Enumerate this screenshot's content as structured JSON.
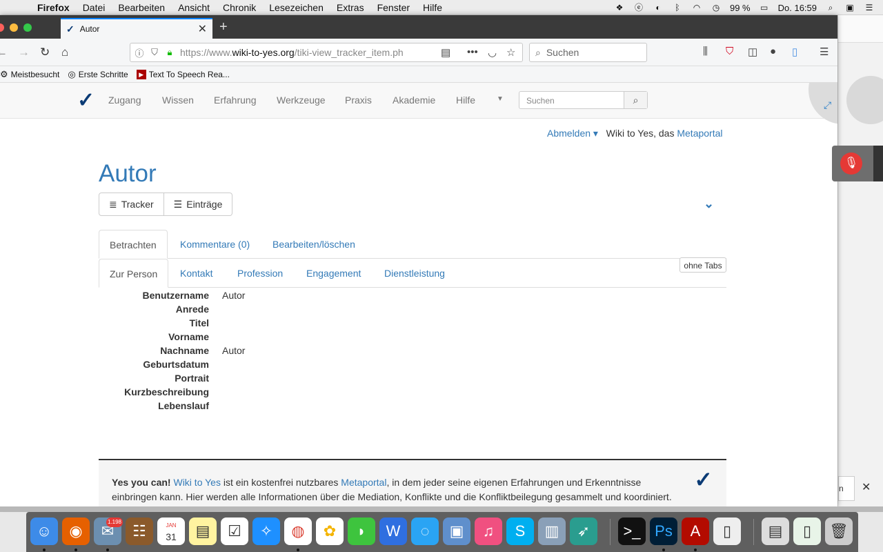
{
  "menubar": {
    "app": "Firefox",
    "items": [
      "Datei",
      "Bearbeiten",
      "Ansicht",
      "Chronik",
      "Lesezeichen",
      "Extras",
      "Fenster",
      "Hilfe"
    ],
    "battery": "99 %",
    "clock": "Do. 16:59"
  },
  "browser": {
    "tab_title": "Autor",
    "url_prefix": "https://www.",
    "url_domain": "wiki-to-yes.org",
    "url_rest": "/tiki-view_tracker_item.ph",
    "search_placeholder": "Suchen",
    "bookmarks": [
      "Meistbesucht",
      "Erste Schritte",
      "Text To Speech Rea..."
    ]
  },
  "site_nav": {
    "items": [
      "Zugang",
      "Wissen",
      "Erfahrung",
      "Werkzeuge",
      "Praxis",
      "Akademie",
      "Hilfe"
    ],
    "search_placeholder": "Suchen"
  },
  "user_line": {
    "logout": "Abmelden",
    "text": "Wiki to Yes, das",
    "link": "Metaportal"
  },
  "page": {
    "title": "Autor",
    "buttons": [
      "Tracker",
      "Einträge"
    ],
    "tabs_main": [
      "Betrachten",
      "Kommentare (0)",
      "Bearbeiten/löschen"
    ],
    "tabs_sub": [
      "Zur Person",
      "Kontakt",
      "Profession",
      "Engagement",
      "Dienstleistung"
    ],
    "ohne_tabs": "ohne Tabs",
    "fields": [
      {
        "label": "Benutzername",
        "value": "Autor"
      },
      {
        "label": "Anrede",
        "value": ""
      },
      {
        "label": "Titel",
        "value": ""
      },
      {
        "label": "Vorname",
        "value": ""
      },
      {
        "label": "Nachname",
        "value": "Autor"
      },
      {
        "label": "Geburtsdatum",
        "value": ""
      },
      {
        "label": "Portrait",
        "value": ""
      },
      {
        "label": "Kurzbeschreibung",
        "value": ""
      },
      {
        "label": "Lebenslauf",
        "value": ""
      }
    ]
  },
  "footer": {
    "bold": "Yes you can!",
    "link1": "Wiki to Yes",
    "text1": "ist ein kostenfrei nutzbares",
    "link2": "Metaportal",
    "text2": ", in dem jeder seine eigenen Erfahrungen und Erkenntnisse",
    "line2": "einbringen kann. Hier werden alle Informationen über die Mediation, Konflikte und die Konfliktbeilegung gesammelt und koordiniert."
  },
  "dock": {
    "mail_badge": "1.198",
    "calendar_month": "JAN",
    "calendar_day": "31"
  },
  "colors": {
    "link": "#337ab7",
    "logo": "#0b3b75",
    "tab_accent": "#0a84ff",
    "mic_red": "#e53935"
  }
}
